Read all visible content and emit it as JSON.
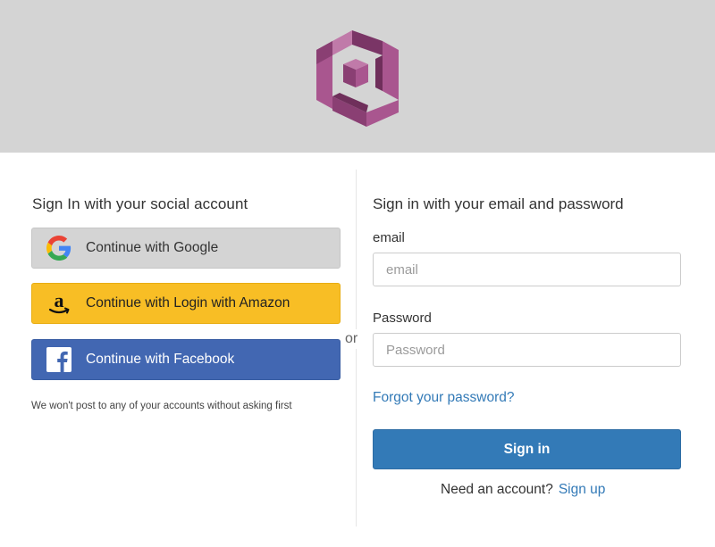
{
  "header": {
    "logo_icon": "cognito-logo-icon",
    "background_color": "#d4d4d4",
    "logo_colors": [
      "#a9568f",
      "#8a3f73",
      "#6f2f5b"
    ]
  },
  "social": {
    "heading": "Sign In with your social account",
    "buttons": [
      {
        "label": "Continue with Google",
        "icon": "google-icon",
        "background": "#d4d4d4"
      },
      {
        "label": "Continue with Login with Amazon",
        "icon": "amazon-icon",
        "background": "#f8be25"
      },
      {
        "label": "Continue with Facebook",
        "icon": "facebook-icon",
        "background": "#4267b2"
      }
    ],
    "note": "We won't post to any of your accounts without asking first"
  },
  "divider": {
    "or_label": "or"
  },
  "email_login": {
    "heading": "Sign in with your email and password",
    "email_label": "email",
    "email_placeholder": "email",
    "email_value": "",
    "password_label": "Password",
    "password_placeholder": "Password",
    "password_value": "",
    "forgot_link": "Forgot your password?",
    "signin_button": "Sign in",
    "need_account_text": "Need an account?",
    "signup_link": "Sign up",
    "accent_color": "#337ab7"
  }
}
